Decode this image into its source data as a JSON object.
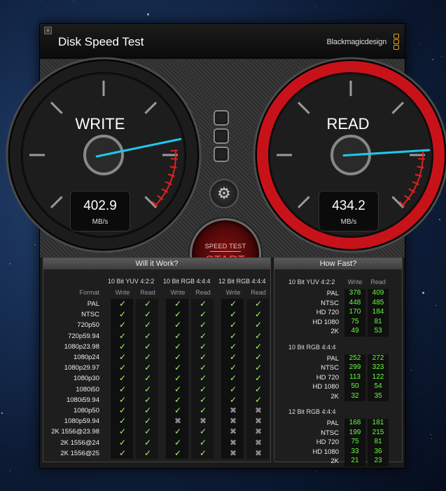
{
  "window": {
    "title": "Disk Speed Test",
    "brand": "Blackmagicdesign",
    "close_icon": "×"
  },
  "write": {
    "label": "WRITE",
    "value": "402.9",
    "unit": "MB/s",
    "needle_fraction": 0.79
  },
  "read": {
    "label": "READ",
    "value": "434.2",
    "unit": "MB/s",
    "needle_fraction": 0.82
  },
  "start_button": {
    "small": "SPEED TEST",
    "big": "START"
  },
  "settings_icon": "⚙",
  "will_it_work": {
    "title": "Will it Work?",
    "format_label": "Format",
    "groups": [
      "10 Bit YUV 4:2:2",
      "10 Bit RGB 4:4:4",
      "12 Bit RGB 4:4:4"
    ],
    "col_write": "Write",
    "col_read": "Read",
    "rows": [
      {
        "format": "PAL",
        "marks": [
          1,
          1,
          1,
          1,
          1,
          1
        ]
      },
      {
        "format": "NTSC",
        "marks": [
          1,
          1,
          1,
          1,
          1,
          1
        ]
      },
      {
        "format": "720p50",
        "marks": [
          1,
          1,
          1,
          1,
          1,
          1
        ]
      },
      {
        "format": "720p59.94",
        "marks": [
          1,
          1,
          1,
          1,
          1,
          1
        ]
      },
      {
        "format": "1080p23.98",
        "marks": [
          1,
          1,
          1,
          1,
          1,
          1
        ]
      },
      {
        "format": "1080p24",
        "marks": [
          1,
          1,
          1,
          1,
          1,
          1
        ]
      },
      {
        "format": "1080p29.97",
        "marks": [
          1,
          1,
          1,
          1,
          1,
          1
        ]
      },
      {
        "format": "1080p30",
        "marks": [
          1,
          1,
          1,
          1,
          1,
          1
        ]
      },
      {
        "format": "1080i50",
        "marks": [
          1,
          1,
          1,
          1,
          1,
          1
        ]
      },
      {
        "format": "1080i59.94",
        "marks": [
          1,
          1,
          1,
          1,
          1,
          1
        ]
      },
      {
        "format": "1080p50",
        "marks": [
          1,
          1,
          1,
          1,
          0,
          0
        ]
      },
      {
        "format": "1080p59.94",
        "marks": [
          1,
          1,
          0,
          0,
          0,
          0
        ]
      },
      {
        "format": "2K 1556@23.98",
        "marks": [
          1,
          1,
          1,
          1,
          0,
          0
        ]
      },
      {
        "format": "2K 1556@24",
        "marks": [
          1,
          1,
          1,
          1,
          0,
          0
        ]
      },
      {
        "format": "2K 1556@25",
        "marks": [
          1,
          1,
          1,
          1,
          0,
          0
        ]
      }
    ],
    "check_glyph": "✓",
    "cross_glyph": "✖"
  },
  "how_fast": {
    "title": "How Fast?",
    "col_write": "Write",
    "col_read": "Read",
    "groups": [
      {
        "name": "10 Bit YUV 4:2:2",
        "rows": [
          {
            "format": "PAL",
            "write": "378",
            "read": "409"
          },
          {
            "format": "NTSC",
            "write": "448",
            "read": "485"
          },
          {
            "format": "HD 720",
            "write": "170",
            "read": "184"
          },
          {
            "format": "HD 1080",
            "write": "75",
            "read": "81"
          },
          {
            "format": "2K",
            "write": "49",
            "read": "53"
          }
        ]
      },
      {
        "name": "10 Bit RGB 4:4:4",
        "rows": [
          {
            "format": "PAL",
            "write": "252",
            "read": "272"
          },
          {
            "format": "NTSC",
            "write": "299",
            "read": "323"
          },
          {
            "format": "HD 720",
            "write": "113",
            "read": "122"
          },
          {
            "format": "HD 1080",
            "write": "50",
            "read": "54"
          },
          {
            "format": "2K",
            "write": "32",
            "read": "35"
          }
        ]
      },
      {
        "name": "12 Bit RGB 4:4:4",
        "rows": [
          {
            "format": "PAL",
            "write": "168",
            "read": "181"
          },
          {
            "format": "NTSC",
            "write": "199",
            "read": "215"
          },
          {
            "format": "HD 720",
            "write": "75",
            "read": "81"
          },
          {
            "format": "HD 1080",
            "write": "33",
            "read": "36"
          },
          {
            "format": "2K",
            "write": "21",
            "read": "23"
          }
        ]
      }
    ]
  }
}
